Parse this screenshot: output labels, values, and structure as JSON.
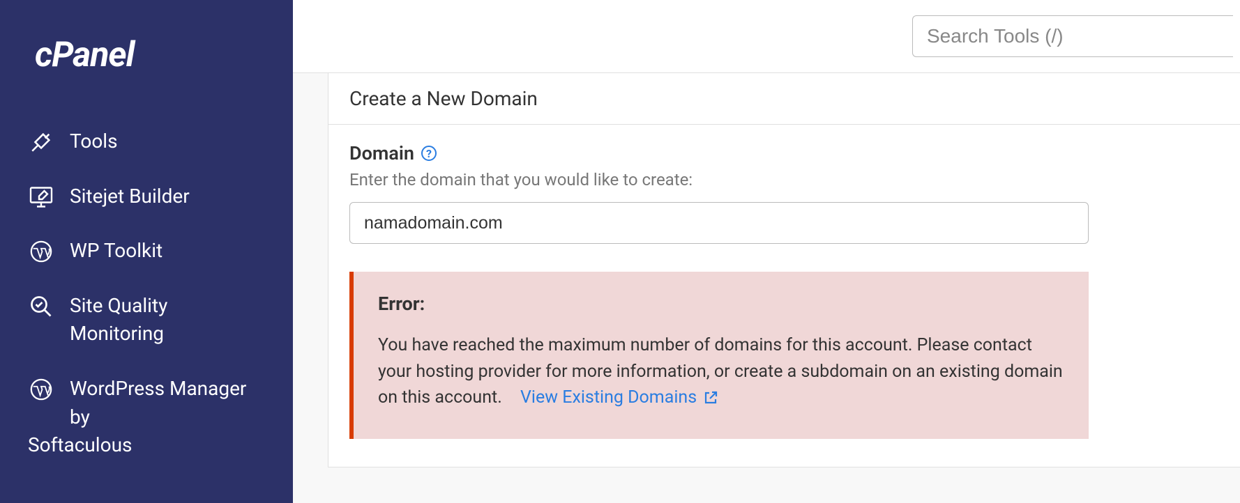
{
  "brand": "cPanel",
  "sidebar": {
    "items": [
      {
        "label": "Tools"
      },
      {
        "label": "Sitejet Builder"
      },
      {
        "label": "WP Toolkit"
      },
      {
        "label": "Site Quality Monitoring"
      },
      {
        "label": "WordPress Manager by Softaculous"
      }
    ]
  },
  "search": {
    "placeholder": "Search Tools (/)"
  },
  "panel": {
    "title": "Create a New Domain",
    "field_label": "Domain",
    "field_hint": "Enter the domain that you would like to create:",
    "domain_value": "namadomain.com"
  },
  "alert": {
    "title": "Error:",
    "message": "You have reached the maximum number of domains for this account. Please contact your hosting provider for more information, or create a subdomain on an existing domain on this account.",
    "link_text": "View Existing Domains"
  }
}
